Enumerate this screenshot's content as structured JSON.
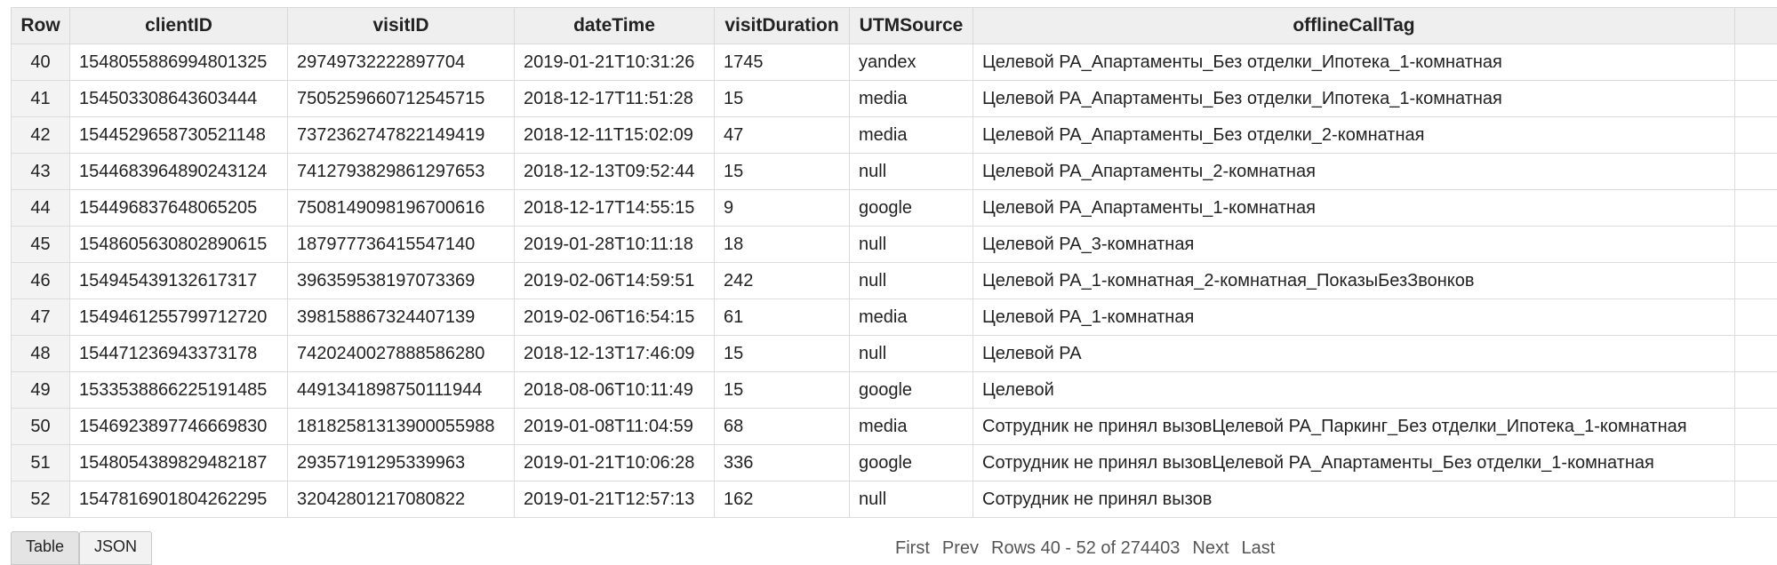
{
  "table": {
    "columns": [
      "Row",
      "clientID",
      "visitID",
      "dateTime",
      "visitDuration",
      "UTMSource",
      "offlineCallTag"
    ],
    "rows": [
      [
        "40",
        "1548055886994801325",
        "29749732222897704",
        "2019-01-21T10:31:26",
        "1745",
        "yandex",
        "Целевой РА_Апартаменты_Без отделки_Ипотека_1-комнатная"
      ],
      [
        "41",
        "154503308643603444",
        "7505259660712545715",
        "2018-12-17T11:51:28",
        "15",
        "media",
        "Целевой РА_Апартаменты_Без отделки_Ипотека_1-комнатная"
      ],
      [
        "42",
        "1544529658730521148",
        "7372362747822149419",
        "2018-12-11T15:02:09",
        "47",
        "media",
        "Целевой РА_Апартаменты_Без отделки_2-комнатная"
      ],
      [
        "43",
        "1544683964890243124",
        "7412793829861297653",
        "2018-12-13T09:52:44",
        "15",
        "null",
        "Целевой РА_Апартаменты_2-комнатная"
      ],
      [
        "44",
        "154496837648065205",
        "7508149098196700616",
        "2018-12-17T14:55:15",
        "9",
        "google",
        "Целевой РА_Апартаменты_1-комнатная"
      ],
      [
        "45",
        "1548605630802890615",
        "187977736415547140",
        "2019-01-28T10:11:18",
        "18",
        "null",
        "Целевой РА_3-комнатная"
      ],
      [
        "46",
        "154945439132617317",
        "396359538197073369",
        "2019-02-06T14:59:51",
        "242",
        "null",
        "Целевой РА_1-комнатная_2-комнатная_ПоказыБезЗвонков"
      ],
      [
        "47",
        "1549461255799712720",
        "398158867324407139",
        "2019-02-06T16:54:15",
        "61",
        "media",
        "Целевой РА_1-комнатная"
      ],
      [
        "48",
        "154471236943373178",
        "7420240027888586280",
        "2018-12-13T17:46:09",
        "15",
        "null",
        "Целевой РА"
      ],
      [
        "49",
        "1533538866225191485",
        "4491341898750111944",
        "2018-08-06T10:11:49",
        "15",
        "google",
        "Целевой"
      ],
      [
        "50",
        "1546923897746669830",
        "18182581313900055988",
        "2019-01-08T11:04:59",
        "68",
        "media",
        "Сотрудник не принял вызовЦелевой РА_Паркинг_Без отделки_Ипотека_1-комнатная"
      ],
      [
        "51",
        "1548054389829482187",
        "29357191295339963",
        "2019-01-21T10:06:28",
        "336",
        "google",
        "Сотрудник не принял вызовЦелевой РА_Апартаменты_Без отделки_1-комнатная"
      ],
      [
        "52",
        "1547816901804262295",
        "32042801217080822",
        "2019-01-21T12:57:13",
        "162",
        "null",
        "Сотрудник не принял вызов"
      ]
    ]
  },
  "footer": {
    "tabs": [
      "Table",
      "JSON"
    ],
    "pager": {
      "first": "First",
      "prev": "Prev",
      "range": "Rows 40 - 52 of 274403",
      "next": "Next",
      "last": "Last"
    }
  }
}
